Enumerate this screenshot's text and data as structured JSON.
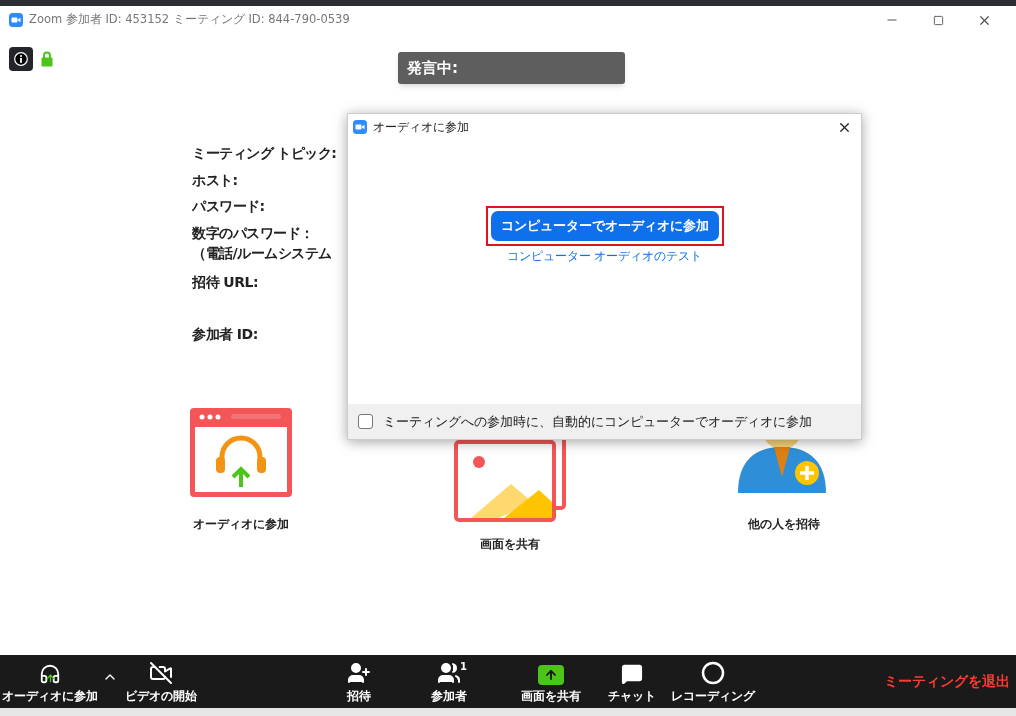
{
  "window": {
    "title": "Zoom 参加者 ID: 453152 ミーティング ID: 844-790-0539"
  },
  "speaker": {
    "label": "発言中:"
  },
  "meeting_info": [
    "ミーティング トピック:",
    "ホスト:",
    "パスワード:",
    "数字のパスワード：",
    "（電話/ルームシステム",
    "招待 URL:",
    "参加者 ID:"
  ],
  "actions": [
    {
      "kind": "audio",
      "label": "オーディオに参加"
    },
    {
      "kind": "share",
      "label": "画面を共有"
    },
    {
      "kind": "invite",
      "label": "他の人を招待"
    }
  ],
  "dialog": {
    "title": "オーディオに参加",
    "primary_button": "コンピューターでオーディオに参加",
    "highlighted": true,
    "test_link": "コンピューター オーディオのテスト",
    "auto_join": {
      "label": "ミーティングへの参加時に、自動的にコンピューターでオーディオに参加",
      "checked": false
    }
  },
  "toolbar": {
    "items": [
      {
        "kind": "audio",
        "label": "オーディオに参加"
      },
      {
        "kind": "caret"
      },
      {
        "kind": "video",
        "label": "ビデオの開始"
      },
      {
        "kind": "invite",
        "label": "招待"
      },
      {
        "kind": "participants",
        "label": "参加者",
        "badge": "1"
      },
      {
        "kind": "share",
        "label": "画面を共有"
      },
      {
        "kind": "chat",
        "label": "チャット"
      },
      {
        "kind": "record",
        "label": "レコーディング"
      }
    ],
    "leave": "ミーティングを退出"
  }
}
